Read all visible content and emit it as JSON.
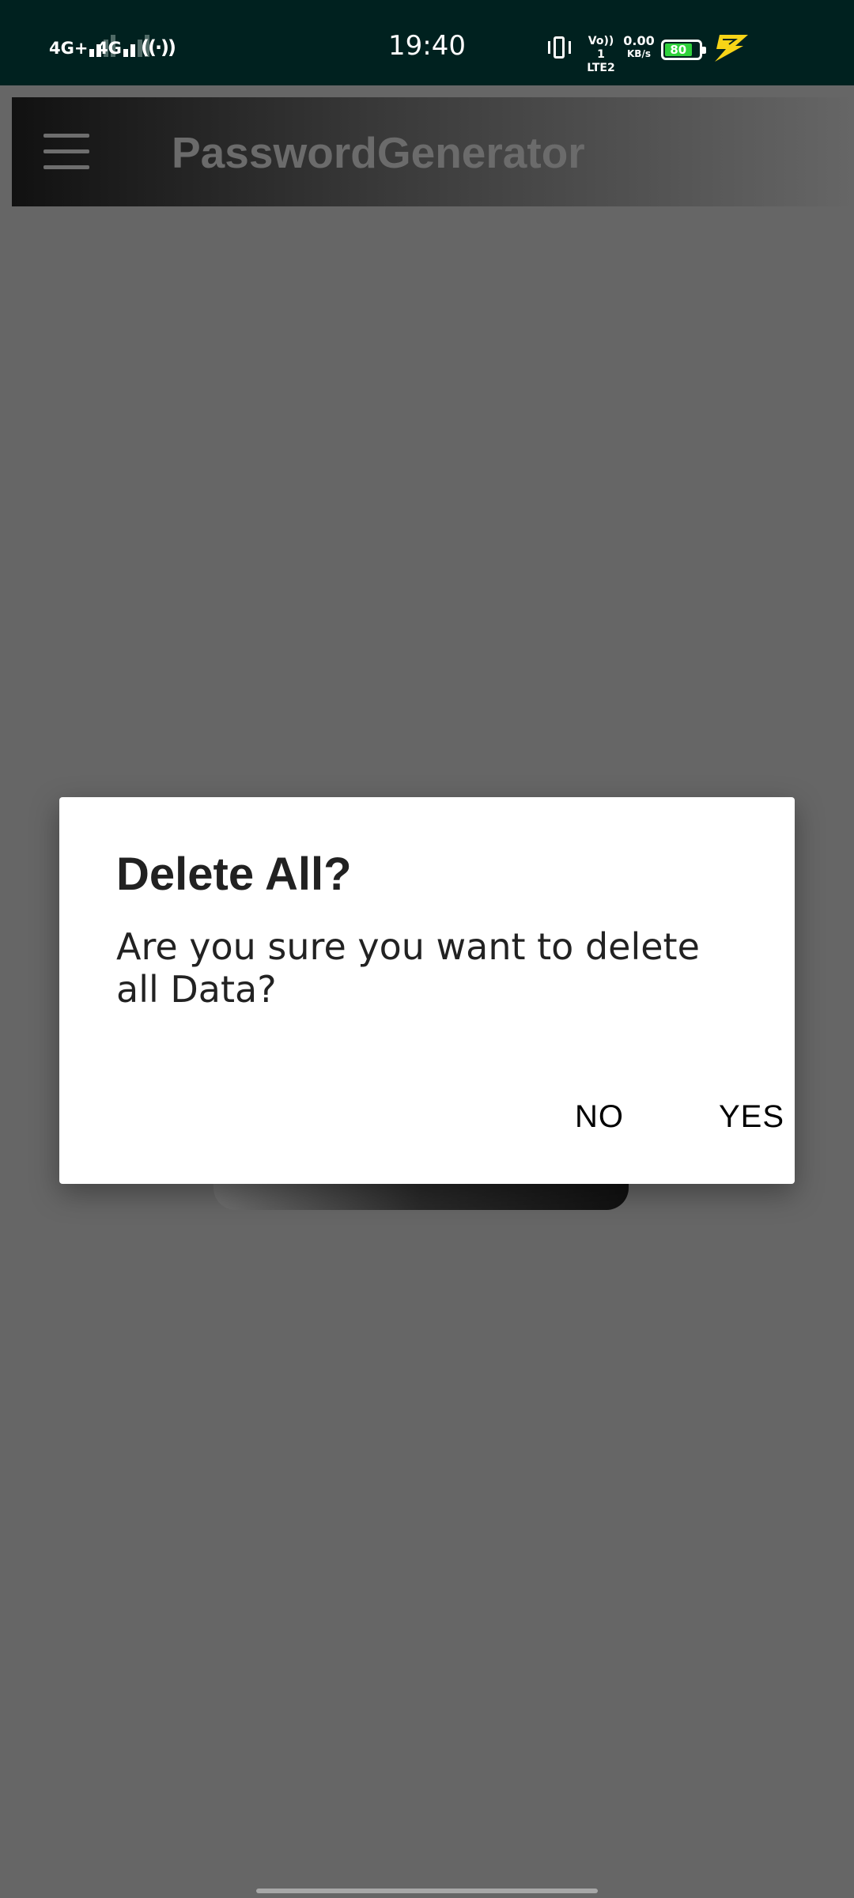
{
  "status_bar": {
    "time": "19:40",
    "sim1_label": "4G+",
    "sim2_label": "4G",
    "hotspot_icon": "hotspot-icon",
    "volte_line1": "Vo)) 1",
    "volte_line2": "LTE2",
    "speed_value": "0.00",
    "speed_unit": "KB/s",
    "battery_level": "80",
    "battery_fraction": 0.8,
    "battery_color": "#2fd23c",
    "charging_color": "#f7d417"
  },
  "app_bar": {
    "menu_icon": "hamburger-menu-icon",
    "title": "PasswordGenerator"
  },
  "dialog": {
    "title": "Delete All?",
    "message": "Are you sure you want to delete all Data?",
    "negative_label": "NO",
    "positive_label": "YES"
  }
}
